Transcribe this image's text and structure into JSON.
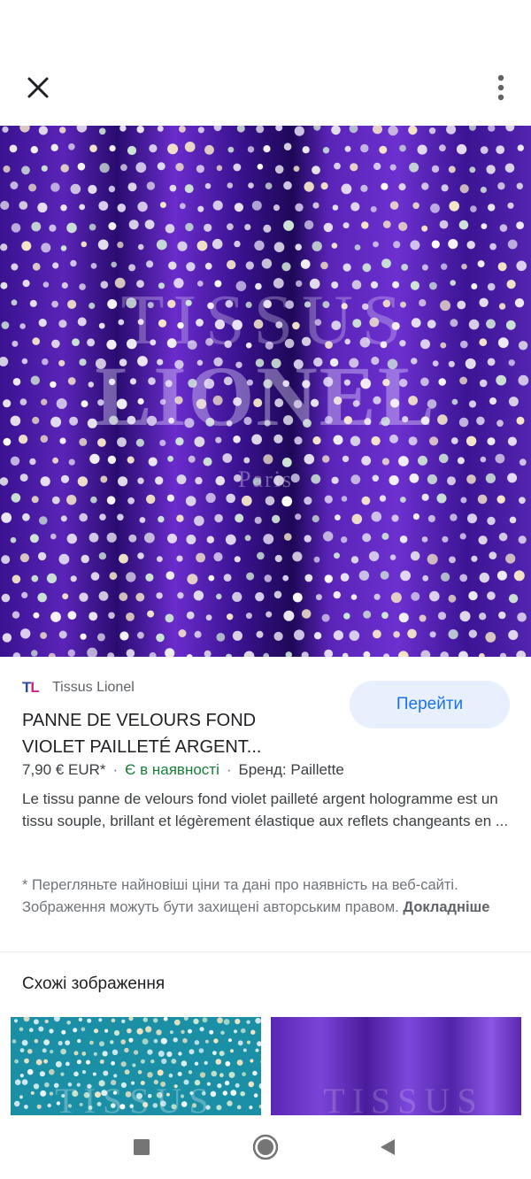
{
  "toolbar": {
    "close_icon": "close-icon",
    "more_icon": "more-vert-icon"
  },
  "hero": {
    "watermark_line1": "TISSUS",
    "watermark_line2": "LIONEL",
    "watermark_line3": "Paris",
    "colors": {
      "fabric": "#4a1aa0",
      "sequin": "#e6e6ec"
    }
  },
  "source": {
    "logo_t": "T",
    "logo_l": "L",
    "name": "Tissus Lionel"
  },
  "product": {
    "title": "PANNE DE VELOURS FOND VIOLET PAILLETÉ ARGENT...",
    "price": "7,90 € EUR*",
    "availability": "Є в наявності",
    "brand": "Бренд: Paillette",
    "description": "Le tissu panne de velours fond violet pailleté argent hologramme est un tissu souple, brillant et légèrement élastique aux reflets changeants en ..."
  },
  "actions": {
    "goto_label": "Перейти"
  },
  "disclaimer": {
    "text": "* Перегляньте найновіші ціни та дані про наявність на веб-сайті. Зображення можуть бути захищені авторським правом. ",
    "more_label": "Докладніше"
  },
  "similar": {
    "title": "Схожі зображення",
    "thumb1_watermark": "TISSUS",
    "thumb2_watermark": "TISSUS",
    "colors": {
      "thumb1": "#1fa3b8",
      "thumb2": "#6a34c9"
    }
  },
  "navbar": {
    "recents_icon": "recents-square-icon",
    "home_icon": "home-circle-icon",
    "back_icon": "back-triangle-icon"
  }
}
